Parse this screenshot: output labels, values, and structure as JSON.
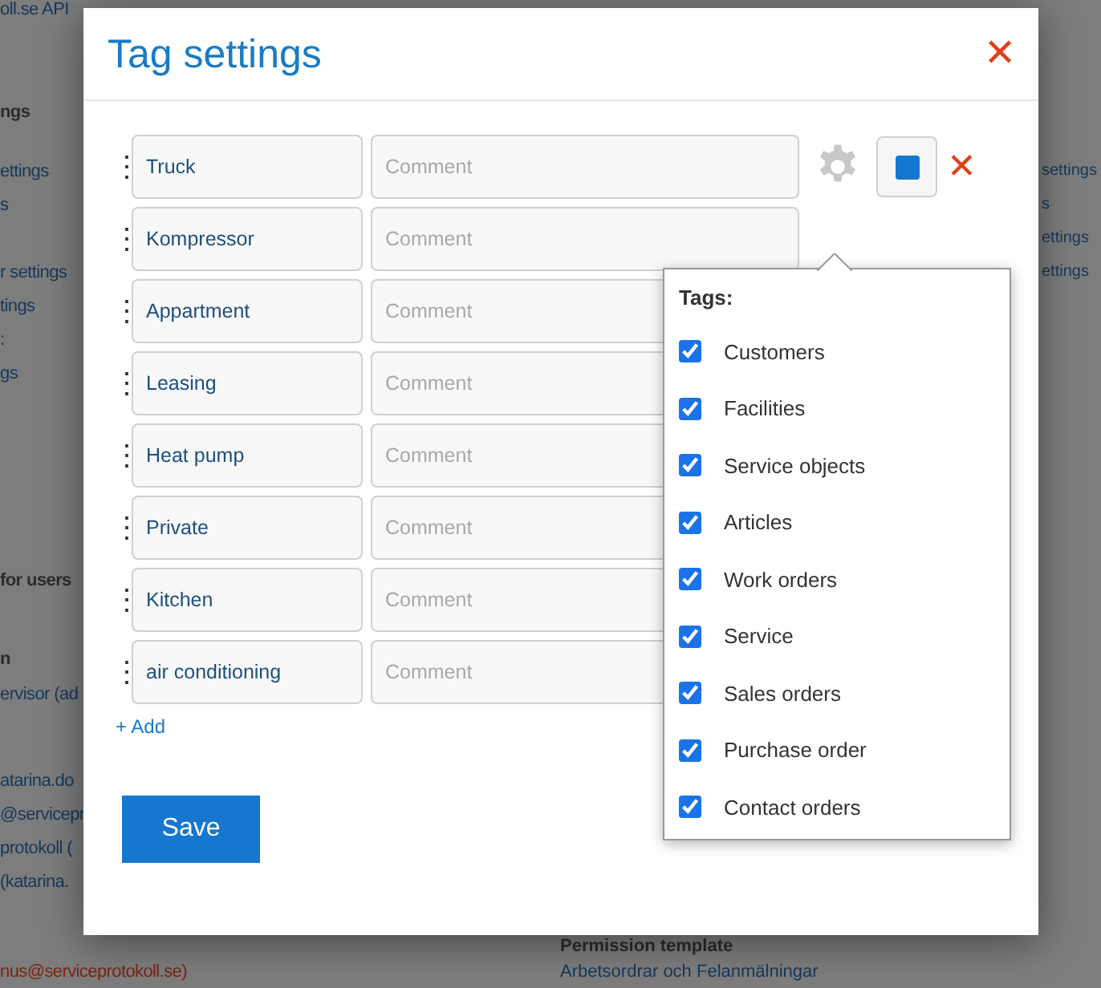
{
  "background_page": {
    "left_column": [
      {
        "text": "oll.se API",
        "kind": "link"
      },
      {
        "text": "ngs",
        "kind": "heading"
      },
      {
        "text": "ettings",
        "kind": "link"
      },
      {
        "text": "s",
        "kind": "link"
      },
      {
        "text": "r settings",
        "kind": "link"
      },
      {
        "text": "tings",
        "kind": "link"
      },
      {
        "text": ":",
        "kind": "link"
      },
      {
        "text": "gs",
        "kind": "link"
      },
      {
        "text": "for users",
        "kind": "heading"
      },
      {
        "text": "n",
        "kind": "heading"
      },
      {
        "text": "ervisor (ad",
        "kind": "link"
      },
      {
        "text": "atarina.do",
        "kind": "link"
      },
      {
        "text": "@servicepr",
        "kind": "link"
      },
      {
        "text": "protokoll (",
        "kind": "link"
      },
      {
        "text": "(katarina.",
        "kind": "link"
      },
      {
        "text": "nus@serviceprotokoll.se)",
        "kind": "alert"
      }
    ],
    "middle_column": [
      {
        "text": "Permission template",
        "kind": "heading"
      },
      {
        "text": "Arbetsordrar och Felanmälningar",
        "kind": "link"
      }
    ],
    "right_column": [
      {
        "text": "settings",
        "kind": "link"
      },
      {
        "text": "s",
        "kind": "link"
      },
      {
        "text": "ettings",
        "kind": "link"
      },
      {
        "text": "ettings",
        "kind": "link"
      }
    ]
  },
  "modal": {
    "title": "Tag settings",
    "close": "✕",
    "tags": [
      {
        "handle": "⋮",
        "name": "Truck",
        "comment_placeholder": "Comment",
        "actions_visible": true,
        "color": "#1577cf",
        "delete": "✕"
      },
      {
        "handle": "⋮",
        "name": "Kompressor",
        "comment_placeholder": "Comment"
      },
      {
        "handle": "⋮",
        "name": "Appartment",
        "comment_placeholder": "Comment"
      },
      {
        "handle": "⋮",
        "name": "Leasing",
        "comment_placeholder": "Comment"
      },
      {
        "handle": "⋮",
        "name": "Heat pump",
        "comment_placeholder": "Comment"
      },
      {
        "handle": "⋮",
        "name": "Private",
        "comment_placeholder": "Comment"
      },
      {
        "handle": "⋮",
        "name": "Kitchen",
        "comment_placeholder": "Comment"
      },
      {
        "handle": "⋮",
        "name": "air conditioning",
        "comment_placeholder": "Comment"
      }
    ],
    "add_link": "+ Add",
    "save_button": "Save",
    "tags_popover": {
      "title": "Tags:",
      "options": [
        {
          "label": "Customers",
          "checked": true
        },
        {
          "label": "Facilities",
          "checked": true
        },
        {
          "label": "Service objects",
          "checked": true
        },
        {
          "label": "Articles",
          "checked": true
        },
        {
          "label": "Work orders",
          "checked": true
        },
        {
          "label": "Service",
          "checked": true
        },
        {
          "label": "Sales orders",
          "checked": true
        },
        {
          "label": "Purchase order",
          "checked": true
        },
        {
          "label": "Contact orders",
          "checked": true
        }
      ]
    }
  }
}
